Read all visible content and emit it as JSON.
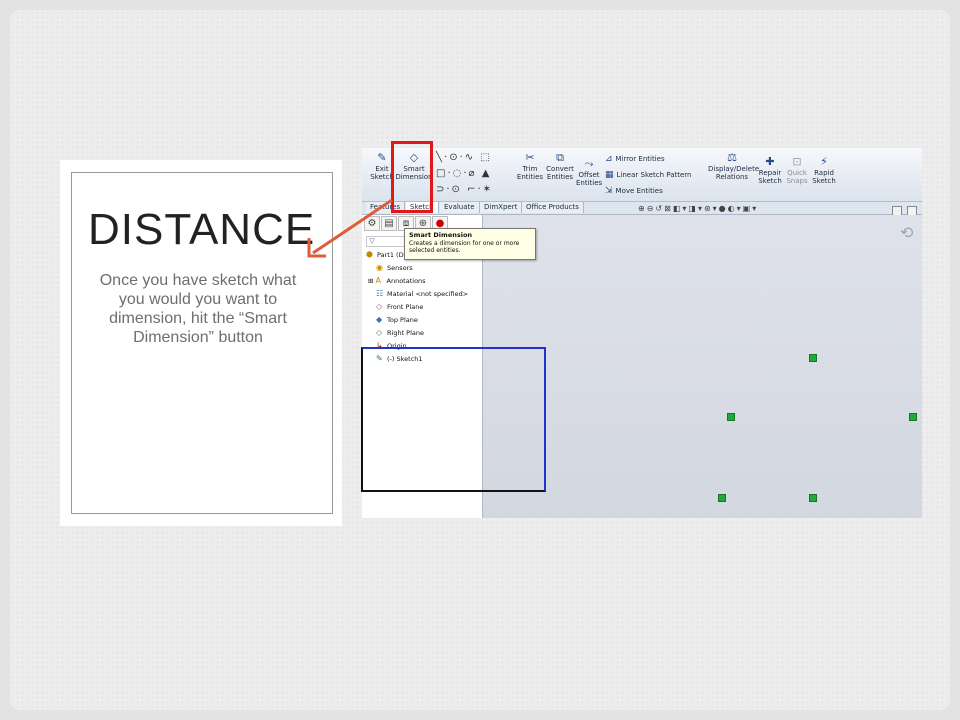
{
  "slide": {
    "title": "DISTANCE",
    "body": "Once you have sketch what you would you want to dimension, hit the “Smart Dimension” button"
  },
  "ribbon": {
    "exit_sketch_line1": "Exit",
    "exit_sketch_line2": "Sketch",
    "smart_dimension_line1": "Smart",
    "smart_dimension_line2": "Dimension",
    "trim_line1": "Trim",
    "trim_line2": "Entities",
    "convert_line1": "Convert",
    "convert_line2": "Entities",
    "offset_line1": "Offset",
    "offset_line2": "Entities",
    "mirror_entities": "Mirror Entities",
    "linear_sketch_pattern": "Linear Sketch Pattern",
    "move_entities": "Move Entities",
    "display_delete_line1": "Display/Delete",
    "display_delete_line2": "Relations",
    "repair_line1": "Repair",
    "repair_line2": "Sketch",
    "quick_snaps_line1": "Quick",
    "quick_snaps_line2": "Snaps",
    "rapid_line1": "Rapid",
    "rapid_line2": "Sketch"
  },
  "tabs": [
    {
      "label": "Features"
    },
    {
      "label": "Sketch"
    },
    {
      "label": "Evaluate"
    },
    {
      "label": "DimXpert"
    },
    {
      "label": "Office Products"
    }
  ],
  "tooltip": {
    "title": "Smart Dimension",
    "body": "Creates a dimension for one or more selected entities."
  },
  "tree": {
    "part": "Part1 (De",
    "items": [
      {
        "label": "Sensors",
        "icon": "sensors-icon"
      },
      {
        "label": "Annotations",
        "icon": "annotations-icon"
      },
      {
        "label": "Material <not specified>",
        "icon": "material-icon"
      },
      {
        "label": "Front Plane",
        "icon": "plane-icon"
      },
      {
        "label": "Top Plane",
        "icon": "plane-icon"
      },
      {
        "label": "Right Plane",
        "icon": "plane-icon"
      },
      {
        "label": "Origin",
        "icon": "origin-icon"
      },
      {
        "label": "(-) Sketch1",
        "icon": "sketch-icon"
      }
    ]
  },
  "colors": {
    "highlight": "#e01818",
    "sketch_line": "#2233cc",
    "relation_marker": "#1faa3a"
  }
}
